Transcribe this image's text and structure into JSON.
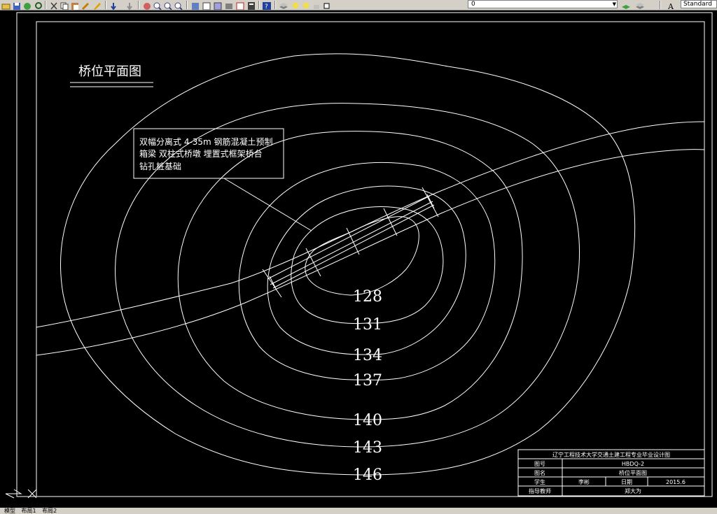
{
  "toolbar": {
    "layer_value": "0",
    "text_style": "Standard"
  },
  "drawing": {
    "title": "桥位平面图",
    "note_lines": [
      "双幅分离式 4-35m 钢筋混凝土预制",
      "箱梁 双柱式桥墩 埋置式框架桥台",
      "钻孔桩基础"
    ],
    "contour_labels": [
      "128",
      "131",
      "134",
      "137",
      "140",
      "143",
      "146"
    ],
    "title_block": {
      "school": "辽宁工程技术大学交通土建工程专业毕业设计图",
      "drawing_no_label": "图号",
      "drawing_no": "HBDQ-2",
      "drawing_name_label": "图名",
      "drawing_name": "桥位平面图",
      "student_label": "学生",
      "student": "李彬",
      "date_label": "日期",
      "date": "2015.6",
      "advisor_label": "指导教师",
      "advisor": "郑大为"
    }
  },
  "tabs": [
    "模型",
    "布局1",
    "布局2"
  ],
  "colors": {
    "background": "#000000",
    "lines": "#ffffff",
    "chrome": "#d4d0c8"
  }
}
